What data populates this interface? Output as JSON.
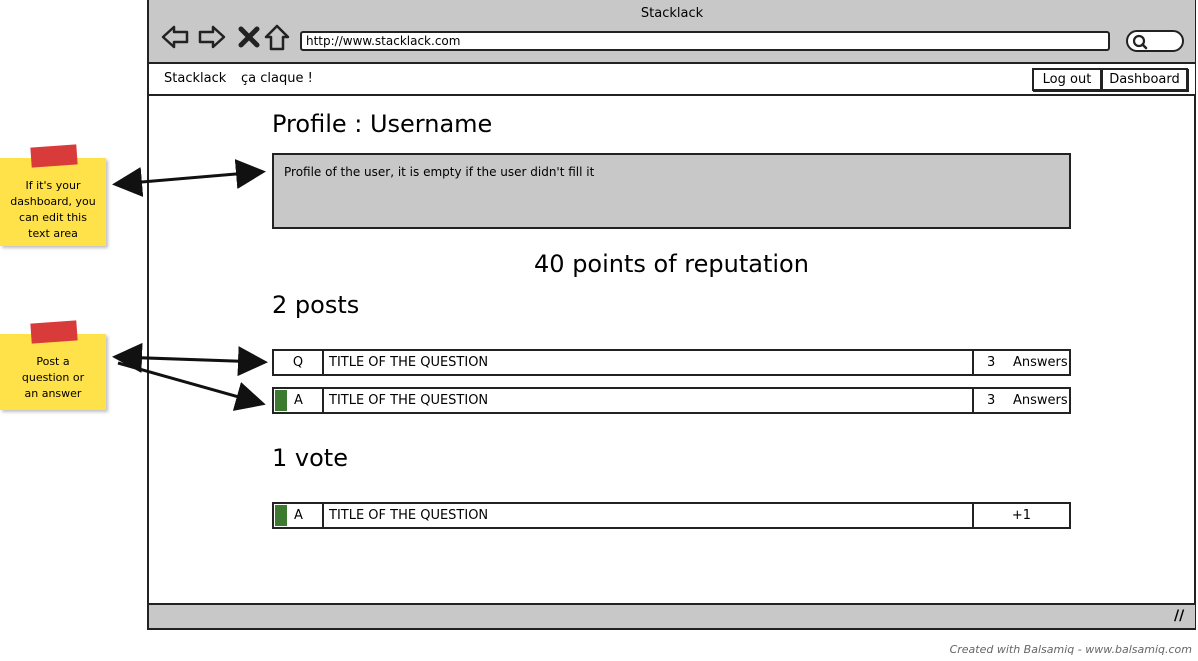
{
  "window": {
    "title": "Stacklack",
    "url": "http://www.stacklack.com"
  },
  "nav_icons": [
    "back-arrow-icon",
    "forward-arrow-icon",
    "close-icon",
    "home-icon",
    "search-icon"
  ],
  "menubar": {
    "brand": "Stacklack",
    "tagline": "ça claque !",
    "logout_label": "Log out",
    "dashboard_label": "Dashboard"
  },
  "profile": {
    "title": "Profile : Username",
    "description": "Profile of the user, it is empty if the user didn't fill it",
    "reputation": "40 points of reputation"
  },
  "posts": {
    "heading": "2 posts",
    "items": [
      {
        "type": "Q",
        "title": "TITLE OF THE QUESTION",
        "count": "3",
        "count_label": "Answers",
        "accepted": false
      },
      {
        "type": "A",
        "title": "TITLE OF THE QUESTION",
        "count": "3",
        "count_label": "Answers",
        "accepted": true
      }
    ]
  },
  "votes": {
    "heading": "1 vote",
    "items": [
      {
        "type": "A",
        "title": "TITLE OF THE QUESTION",
        "value": "+1",
        "accepted": true
      }
    ]
  },
  "notes": {
    "edit_note": "If it's your dashboard, you can edit this text area",
    "post_note": "Post a question or an answer"
  },
  "colors": {
    "chrome_gray": "#c8c8c8",
    "accepted_green": "#3c7a2f",
    "note_yellow": "#ffe14a",
    "tape_red": "#d93a3a"
  },
  "credit": "Created with Balsamiq - www.balsamiq.com"
}
